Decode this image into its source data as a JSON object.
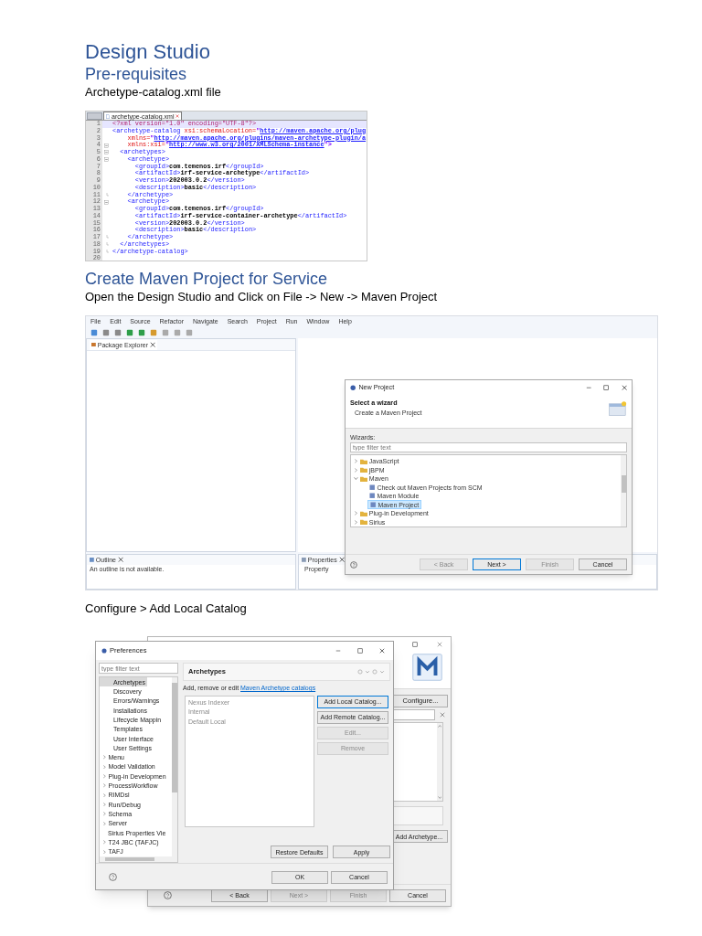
{
  "title": "Design Studio",
  "sections": [
    {
      "heading": "Pre-requisites",
      "text": "Archetype-catalog.xml file",
      "figure": {
        "kind": "code_editor",
        "tabs": [
          {
            "label": "archetype-catalog.xml",
            "selected": true
          }
        ],
        "lines": [
          {
            "number": "1",
            "current": true,
            "kind": "plain",
            "parts": [
              {
                "kind": "pi",
                "text": "<?xml version=\"1.0\" encoding=\"UTF-8\"?>"
              }
            ]
          },
          {
            "number": "2",
            "current": false,
            "kind": "plain",
            "parts": [
              {
                "kind": "tag",
                "text": "<archetype-catalog "
              },
              {
                "kind": "attr",
                "text": "xsi:schemaLocation="
              },
              {
                "kind": "value",
                "text": "\""
              },
              {
                "kind": "url",
                "text": "http://maven.apache.org/plug"
              }
            ]
          },
          {
            "number": "3",
            "current": false,
            "kind": "plain",
            "parts": [
              {
                "kind": "attr",
                "text": "    xmlns="
              },
              {
                "kind": "value",
                "text": "\""
              },
              {
                "kind": "url",
                "text": "http://maven.apache.org/plugins/maven-archetype-plugin/a"
              }
            ]
          },
          {
            "number": "4",
            "current": false,
            "kind": "fold_start",
            "parts": [
              {
                "kind": "attr",
                "text": "    xmlns:xsi="
              },
              {
                "kind": "value",
                "text": "\""
              },
              {
                "kind": "url",
                "text": "http://www.w3.org/2001/XMLSchema-instance"
              },
              {
                "kind": "value",
                "text": "\">"
              }
            ]
          },
          {
            "number": "5",
            "current": false,
            "kind": "fold_start",
            "parts": [
              {
                "kind": "tag",
                "text": "  <archetypes>"
              }
            ]
          },
          {
            "number": "6",
            "current": false,
            "kind": "fold_start",
            "parts": [
              {
                "kind": "tag",
                "text": "    <archetype>"
              }
            ]
          },
          {
            "number": "7",
            "current": false,
            "kind": "plain",
            "parts": [
              {
                "kind": "tag",
                "text": "      <groupId>"
              },
              {
                "kind": "text",
                "text": "com.temenos.irf"
              },
              {
                "kind": "tag",
                "text": "</groupId>"
              }
            ]
          },
          {
            "number": "8",
            "current": false,
            "kind": "plain",
            "parts": [
              {
                "kind": "tag",
                "text": "      <artifactId>"
              },
              {
                "kind": "text",
                "text": "irf-service-archetype"
              },
              {
                "kind": "tag",
                "text": "</artifactId>"
              }
            ]
          },
          {
            "number": "9",
            "current": false,
            "kind": "plain",
            "parts": [
              {
                "kind": "tag",
                "text": "      <version>"
              },
              {
                "kind": "text",
                "text": "202003.0.2"
              },
              {
                "kind": "tag",
                "text": "</version>"
              }
            ]
          },
          {
            "number": "10",
            "current": false,
            "kind": "plain",
            "parts": [
              {
                "kind": "tag",
                "text": "      <description>"
              },
              {
                "kind": "text",
                "text": "basic"
              },
              {
                "kind": "tag",
                "text": "</description>"
              }
            ]
          },
          {
            "number": "11",
            "current": false,
            "kind": "fold_end",
            "parts": [
              {
                "kind": "tag",
                "text": "    </archetype>"
              }
            ]
          },
          {
            "number": "12",
            "current": false,
            "kind": "fold_start",
            "parts": [
              {
                "kind": "tag",
                "text": "    <archetype>"
              }
            ]
          },
          {
            "number": "13",
            "current": false,
            "kind": "plain",
            "parts": [
              {
                "kind": "tag",
                "text": "      <groupId>"
              },
              {
                "kind": "text",
                "text": "com.temenos.irf"
              },
              {
                "kind": "tag",
                "text": "</groupId>"
              }
            ]
          },
          {
            "number": "14",
            "current": false,
            "kind": "plain",
            "parts": [
              {
                "kind": "tag",
                "text": "      <artifactId>"
              },
              {
                "kind": "text",
                "text": "irf-service-container-archetype"
              },
              {
                "kind": "tag",
                "text": "</artifactId>"
              }
            ]
          },
          {
            "number": "15",
            "current": false,
            "kind": "plain",
            "parts": [
              {
                "kind": "tag",
                "text": "      <version>"
              },
              {
                "kind": "text",
                "text": "202003.0.2"
              },
              {
                "kind": "tag",
                "text": "</version>"
              }
            ]
          },
          {
            "number": "16",
            "current": false,
            "kind": "plain",
            "parts": [
              {
                "kind": "tag",
                "text": "      <description>"
              },
              {
                "kind": "text",
                "text": "basic"
              },
              {
                "kind": "tag",
                "text": "</description>"
              }
            ]
          },
          {
            "number": "17",
            "current": false,
            "kind": "fold_end",
            "parts": [
              {
                "kind": "tag",
                "text": "    </archetype>"
              }
            ]
          },
          {
            "number": "18",
            "current": false,
            "kind": "fold_end",
            "parts": [
              {
                "kind": "tag",
                "text": "  </archetypes>"
              }
            ]
          },
          {
            "number": "19",
            "current": false,
            "kind": "fold_end",
            "parts": [
              {
                "kind": "tag",
                "text": "</archetype-catalog>"
              }
            ]
          },
          {
            "number": "20",
            "current": false,
            "kind": "plain"
          }
        ]
      }
    },
    {
      "heading": "Create Maven Project for Service",
      "text": "Open the Design Studio and Click on File -> New -> Maven Project",
      "figure": {
        "kind": "workbench",
        "menu": [
          "File",
          "Edit",
          "Source",
          "Refactor",
          "Navigate",
          "Search",
          "Project",
          "Run",
          "Window",
          "Help"
        ],
        "package_explorer": {
          "title": "Package Explorer"
        },
        "outline": {
          "title": "Outline",
          "message": "An outline is not available."
        },
        "properties": {
          "title": "Properties",
          "column_1": "Property"
        },
        "dialog": {
          "title": "New Project",
          "heading": "Select a wizard",
          "description": "Create a Maven Project",
          "filter_label": "Wizards:",
          "filter": {
            "placeholder": "type filter text"
          },
          "tree": [
            {
              "label": "JavaScript",
              "expanded": false,
              "selected": false
            },
            {
              "label": "jBPM",
              "expanded": false,
              "selected": false
            },
            {
              "label": "Maven",
              "expanded": true,
              "selected": false,
              "children": [
                {
                  "label": "Check out Maven Projects from SCM",
                  "selected": false
                },
                {
                  "label": "Maven Module",
                  "selected": false
                },
                {
                  "label": "Maven Project",
                  "selected": true
                }
              ]
            },
            {
              "label": "Plug-in Development",
              "expanded": false,
              "selected": false
            },
            {
              "label": "Sirius",
              "expanded": false,
              "selected": false
            }
          ],
          "buttons": [
            {
              "label": "< Back",
              "disabled": true,
              "default": false
            },
            {
              "label": "Next >",
              "disabled": false,
              "default": true
            },
            {
              "label": "Finish",
              "disabled": true,
              "default": false
            },
            {
              "label": "Cancel",
              "disabled": false,
              "default": false
            }
          ]
        }
      }
    },
    {
      "text": "Configure > Add Local Catalog",
      "figure": {
        "kind": "preferences",
        "back_dialog": {
          "configure_button": "Configure...",
          "add_archetype_button": "Add Archetype...",
          "buttons": [
            {
              "label": "< Back",
              "disabled": false
            },
            {
              "label": "Next >",
              "disabled": true
            },
            {
              "label": "Finish",
              "disabled": true
            },
            {
              "label": "Cancel",
              "disabled": false
            }
          ]
        },
        "dialog": {
          "title": "Preferences",
          "filter": {
            "placeholder": "type filter text"
          },
          "tree": [
            {
              "label": "Archetypes",
              "kind": "child",
              "selected": true
            },
            {
              "label": "Discovery",
              "kind": "child",
              "selected": false
            },
            {
              "label": "Errors/Warnings",
              "kind": "child",
              "selected": false
            },
            {
              "label": "Installations",
              "kind": "child",
              "selected": false
            },
            {
              "label": "Lifecycle Mappin",
              "kind": "child",
              "selected": false
            },
            {
              "label": "Templates",
              "kind": "child",
              "selected": false
            },
            {
              "label": "User Interface",
              "kind": "child",
              "selected": false
            },
            {
              "label": "User Settings",
              "kind": "child",
              "selected": false
            },
            {
              "label": "Menu",
              "kind": "group",
              "selected": false
            },
            {
              "label": "Model Validation",
              "kind": "group",
              "selected": false
            },
            {
              "label": "Plug-in Developmen",
              "kind": "group",
              "selected": false
            },
            {
              "label": "ProcessWorkflow",
              "kind": "group",
              "selected": false
            },
            {
              "label": "RIMDsl",
              "kind": "group",
              "selected": false
            },
            {
              "label": "Run/Debug",
              "kind": "group",
              "selected": false
            },
            {
              "label": "Schema",
              "kind": "group",
              "selected": false
            },
            {
              "label": "Server",
              "kind": "group",
              "selected": false
            },
            {
              "label": "Sirius Properties Vie",
              "kind": "leaf",
              "selected": false
            },
            {
              "label": "T24 JBC (TAFJC)",
              "kind": "group",
              "selected": false
            },
            {
              "label": "TAFJ",
              "kind": "group",
              "selected": false
            }
          ],
          "page_title": "Archetypes",
          "description": "Add, remove or edit ",
          "link": "Maven Archetype catalogs",
          "catalogs": [
            {
              "label": "Nexus Indexer",
              "disabled": true
            },
            {
              "label": "Internal",
              "disabled": true
            },
            {
              "label": "Default Local",
              "disabled": true
            }
          ],
          "side_buttons": [
            {
              "label": "Add Local Catalog...",
              "disabled": false,
              "focused": true
            },
            {
              "label": "Add Remote Catalog...",
              "disabled": false,
              "focused": false
            },
            {
              "label": "Edit...",
              "disabled": true,
              "focused": false
            },
            {
              "label": "Remove",
              "disabled": true,
              "focused": false
            }
          ],
          "page_buttons": [
            "Restore Defaults",
            "Apply"
          ],
          "buttons": [
            "OK",
            "Cancel"
          ]
        }
      }
    }
  ]
}
